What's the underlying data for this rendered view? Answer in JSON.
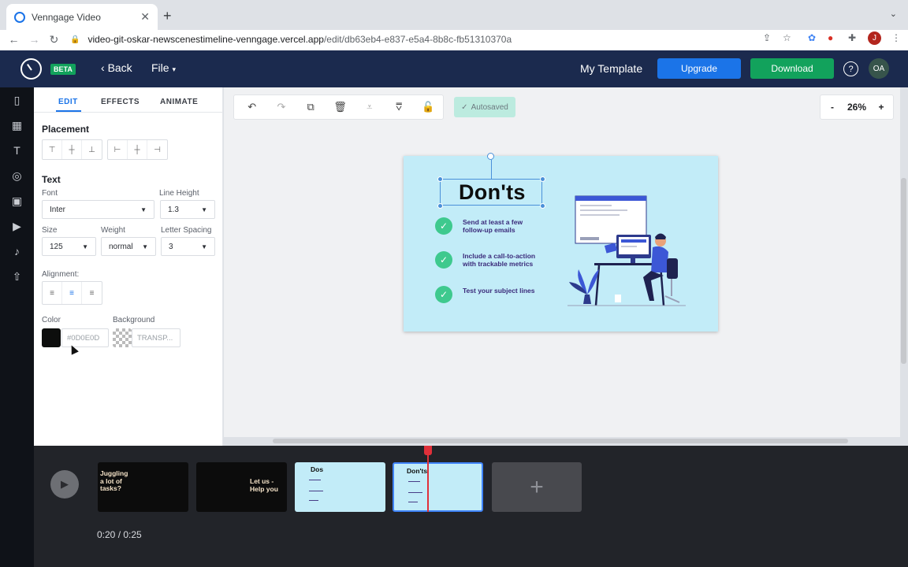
{
  "browser": {
    "tab_title": "Venngage Video",
    "url_host": "video-git-oskar-newscenestimeline-venngage.vercel.app",
    "url_path": "/edit/db63eb4-e837-e5a4-8b8c-fb51310370a",
    "profile_initial": "J"
  },
  "header": {
    "beta": "BETA",
    "back": "Back",
    "file": "File",
    "template_name": "My Template",
    "upgrade": "Upgrade",
    "download": "Download",
    "help": "?",
    "avatar": "OA"
  },
  "panel": {
    "tabs": [
      "EDIT",
      "EFFECTS",
      "ANIMATE"
    ],
    "placement": "Placement",
    "text_heading": "Text",
    "font_label": "Font",
    "font_value": "Inter",
    "line_height_label": "Line Height",
    "line_height_value": "1.3",
    "size_label": "Size",
    "size_value": "125",
    "weight_label": "Weight",
    "weight_value": "normal",
    "letter_spacing_label": "Letter Spacing",
    "letter_spacing_value": "3",
    "alignment_label": "Alignment:",
    "color_label": "Color",
    "color_value": "#0D0E0D",
    "background_label": "Background",
    "background_value": "TRANSP..."
  },
  "canvas": {
    "autosaved": "Autosaved",
    "zoom": "26%",
    "zoom_minus": "-",
    "zoom_plus": "+",
    "slide_title": "Don'ts",
    "bullets": [
      "Send at least a few\nfollow-up emails",
      "Include a call-to-action\nwith trackable metrics",
      "Test your subject lines"
    ],
    "bg_color": "#c2ecf8"
  },
  "timeline": {
    "scenes": [
      {
        "text": "Juggling\na lot of\ntasks?"
      },
      {
        "text": "Let us -\nHelp you"
      },
      {
        "text": "Dos"
      },
      {
        "text": "Don'ts"
      }
    ],
    "time": "0:20 / 0:25"
  },
  "colors": {
    "accent": "#1b74e8",
    "success": "#12a25c",
    "header_bg": "#1b2a4e"
  }
}
